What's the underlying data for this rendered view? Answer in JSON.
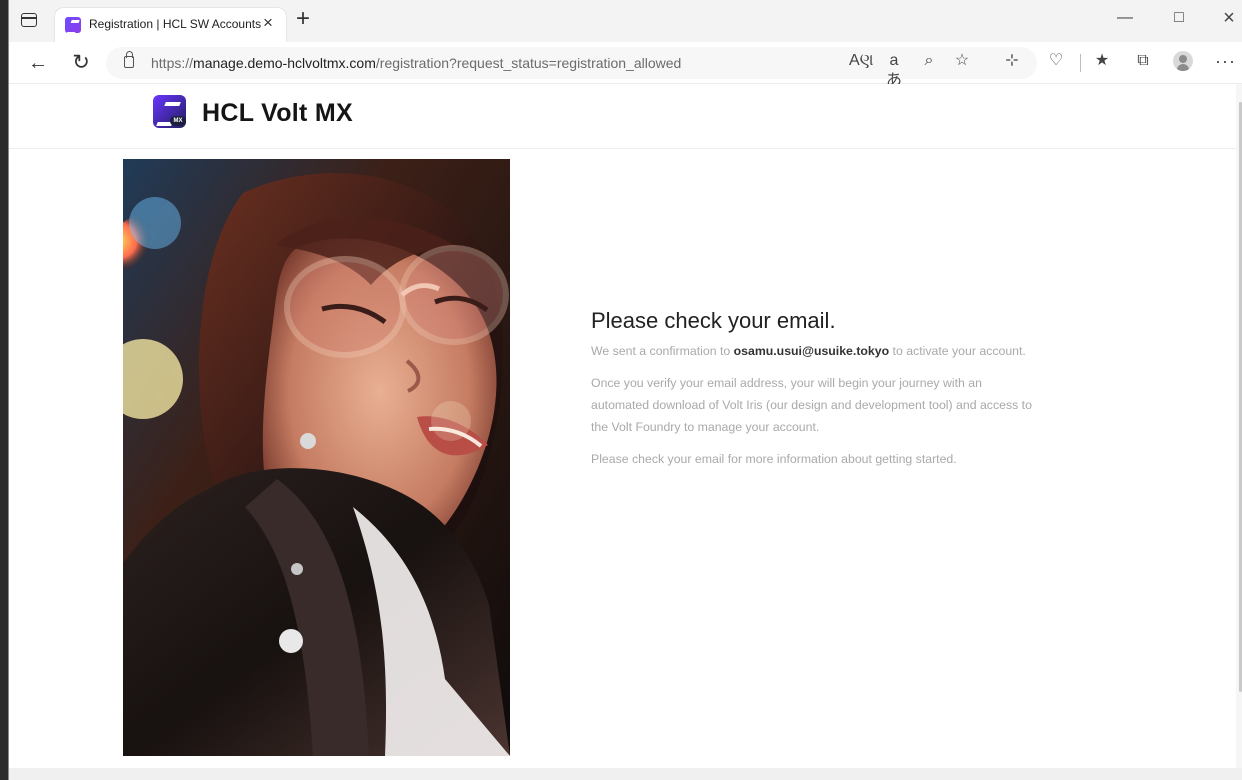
{
  "browser": {
    "tab_title": "Registration | HCL SW Accounts",
    "new_tab_symbol": "+",
    "close_tab_symbol": "×",
    "url_prefix": "https://",
    "url_domain": "manage.demo-hclvoltmx.com",
    "url_path": "/registration?request_status=registration_allowed",
    "toolbar_icons": {
      "read_aloud": "Aણ",
      "translate": "aあ",
      "zoom": "⌕",
      "favorite": "☆",
      "extensions": "⊹",
      "browser_essentials": "♡",
      "favorites": "★",
      "collections": "⧉",
      "more": "···"
    }
  },
  "site": {
    "brand": "HCL Volt MX"
  },
  "message": {
    "title": "Please check your email.",
    "paragraph1_before": "We sent a confirmation to ",
    "email": "osamu.usui@usuike.tokyo",
    "paragraph1_after": " to activate your account.",
    "paragraph2": "Once you verify your email address, your will begin your journey with an automated download of Volt Iris (our design and development tool) and access to the Volt Foundry to manage your account.",
    "paragraph3": "Please check your email for more information about getting started."
  }
}
